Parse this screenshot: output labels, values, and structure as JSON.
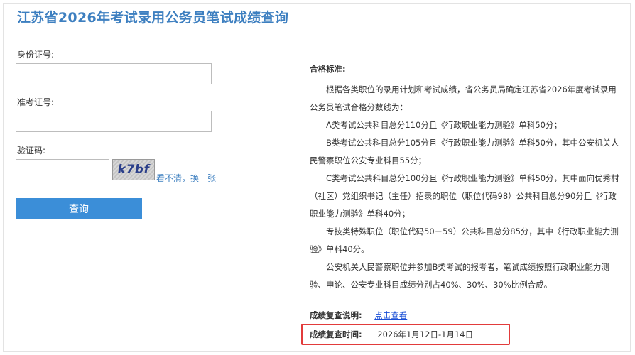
{
  "page": {
    "title": "江苏省2026年考试录用公务员笔试成绩查询"
  },
  "form": {
    "id_label": "身份证号:",
    "id_value": "",
    "ticket_label": "准考证号:",
    "ticket_value": "",
    "captcha_label": "验证码:",
    "captcha_value": "",
    "captcha_text": "k7bf",
    "refresh_link": "看不清，换一张",
    "submit_label": "查询"
  },
  "standards": {
    "title": "合格标准:",
    "paragraphs": [
      "根据各类职位的录用计划和考试成绩，省公务员局确定江苏省2026年度考试录用公务员笔试合格分数线为：",
      "A类考试公共科目总分110分且《行政职业能力测验》单科50分；",
      "B类考试公共科目总分105分且《行政职业能力测验》单科50分，其中公安机关人民警察职位公安专业科目55分；",
      "C类考试公共科目总分100分且《行政职业能力测验》单科50分，其中面向优秀村（社区）党组织书记（主任）招录的职位（职位代码98）公共科目总分90分且《行政职业能力测验》单科40分；",
      "专技类特殊职位（职位代码50－59）公共科目总分85分，其中《行政职业能力测验》单科40分。",
      "公安机关人民警察职位并参加B类考试的报考者，笔试成绩按照行政职业能力测验、申论、公安专业科目成绩分别占40%、30%、30%比例合成。"
    ]
  },
  "review": {
    "label": "成绩复查说明:",
    "link": "点击查看",
    "time_label": "成绩复查时间:",
    "time_value": "2026年1月12日-1月14日"
  },
  "colors": {
    "title": "#3d7fc0",
    "button": "#3b8ed8",
    "highlight": "#e23b3b",
    "link": "#1a4fd6"
  }
}
